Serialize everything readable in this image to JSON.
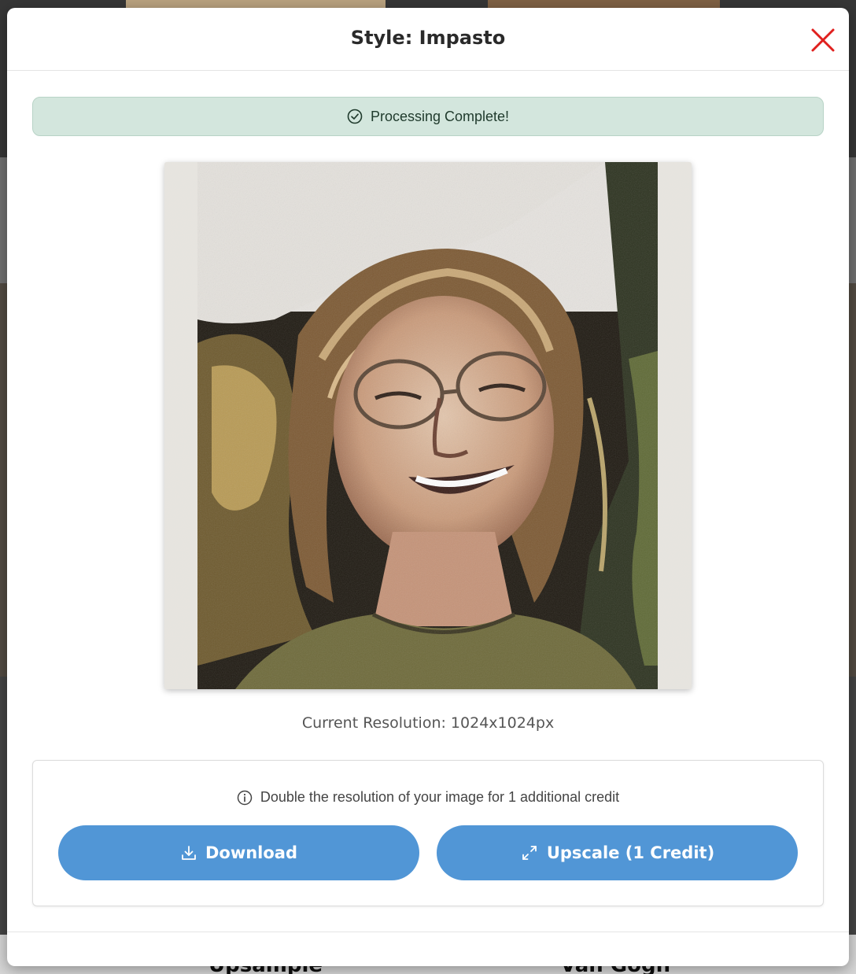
{
  "background": {
    "captions": [
      "Upsample",
      "Van Gogh"
    ]
  },
  "modal": {
    "title": "Style: Impasto",
    "close_icon": "close-icon",
    "alert": {
      "icon": "check-circle-icon",
      "text": "Processing Complete!",
      "color": "#d3e6dd"
    },
    "image": {
      "description_icon": "portrait-image"
    },
    "resolution_text": "Current Resolution: 1024x1024px",
    "upscale": {
      "info_icon": "info-icon",
      "info_text": "Double the resolution of your image for 1 additional credit",
      "download_label": "Download",
      "download_icon": "download-icon",
      "upscale_label": "Upscale (1 Credit)",
      "upscale_icon": "expand-icon"
    },
    "colors": {
      "accent": "#5196d6",
      "close": "#e0201e"
    }
  }
}
